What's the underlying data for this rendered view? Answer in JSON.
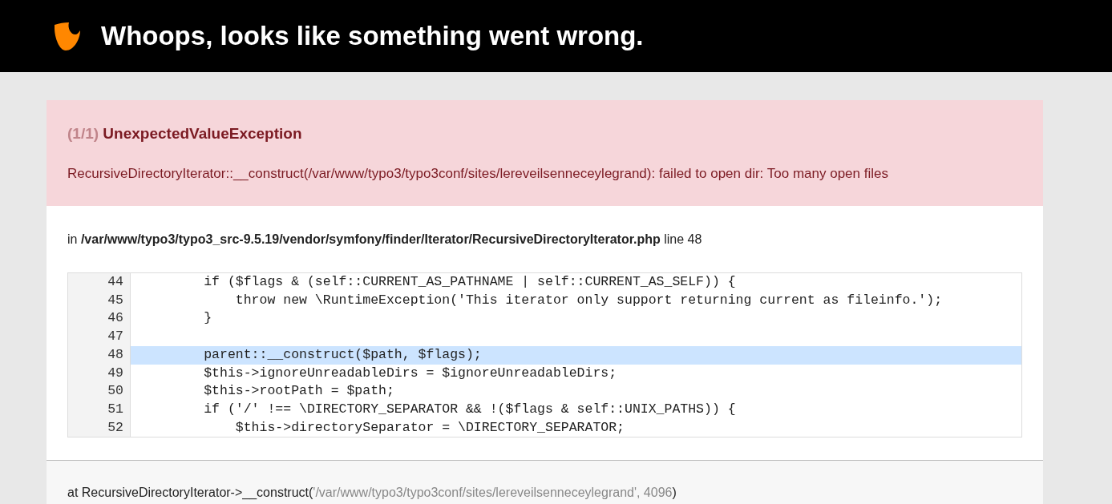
{
  "header": {
    "title": "Whoops, looks like something went wrong."
  },
  "exception": {
    "count": "(1/1)",
    "name": "UnexpectedValueException",
    "message": "RecursiveDirectoryIterator::__construct(/var/www/typo3/typo3conf/sites/lereveilsenneceylegrand): failed to open dir: Too many open files"
  },
  "location": "in **/var/www/typo3/typo3_src-9.5.19/vendor/symfony/finder/Iterator/RecursiveDirectoryIterator.php** line 48",
  "code": [
    {
      "number": "44",
      "text": "        if ($flags & (self::CURRENT_AS_PATHNAME | self::CURRENT_AS_SELF)) {",
      "selected": false
    },
    {
      "number": "45",
      "text": "            throw new \\RuntimeException('This iterator only support returning current as fileinfo.');",
      "selected": false
    },
    {
      "number": "46",
      "text": "        }",
      "selected": false
    },
    {
      "number": "47",
      "selected": false
    },
    {
      "number": "48",
      "text": "        parent::__construct($path, $flags);",
      "selected": true
    },
    {
      "number": "49",
      "text": "        $this->ignoreUnreadableDirs = $ignoreUnreadableDirs;",
      "selected": false
    },
    {
      "number": "50",
      "text": "        $this->rootPath = $path;",
      "selected": false
    },
    {
      "number": "51",
      "text": "        if ('/' !== \\DIRECTORY_SEPARATOR && !($flags & self::UNIX_PATHS)) {",
      "selected": false
    },
    {
      "number": "52",
      "text": "            $this->directorySeparator = \\DIRECTORY_SEPARATOR;",
      "selected": false
    }
  ],
  "trace": {
    "call": "at RecursiveDirectoryIterator->__construct(",
    "args": "'/var/www/typo3/typo3conf/sites/lereveilsenneceylegrand', 4096",
    "close": ")"
  }
}
